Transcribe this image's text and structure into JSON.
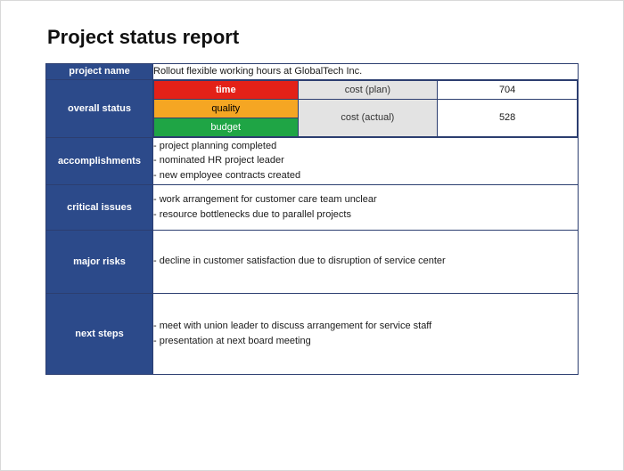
{
  "title": "Project status report",
  "rows": {
    "project_name_label": "project name",
    "project_name_value": "Rollout flexible working hours at GlobalTech Inc.",
    "overall_status_label": "overall status",
    "status": {
      "time_label": "time",
      "quality_label": "quality",
      "budget_label": "budget",
      "cost_plan_label": "cost (plan)",
      "cost_plan_value": "704",
      "cost_actual_label": "cost (actual)",
      "cost_actual_value": "528",
      "colors": {
        "time": "#e32118",
        "quality": "#f5a623",
        "budget": "#1fa545"
      }
    },
    "accomplishments_label": "accomplishments",
    "accomplishments_text": "- project planning completed\n- nominated HR project leader\n- new employee contracts created",
    "critical_issues_label": "critical issues",
    "critical_issues_text": "- work arrangement for customer care team unclear\n- resource bottlenecks due to parallel projects",
    "major_risks_label": "major risks",
    "major_risks_text": "- decline in customer satisfaction due to disruption of service center",
    "next_steps_label": "next steps",
    "next_steps_text": "- meet with union leader to discuss arrangement for service staff\n- presentation at next board meeting"
  }
}
